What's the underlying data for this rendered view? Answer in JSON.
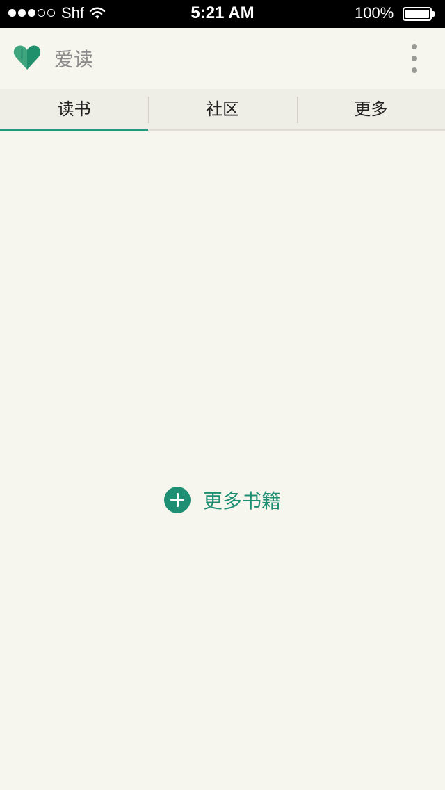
{
  "status_bar": {
    "carrier": "Shf",
    "time": "5:21 AM",
    "battery": "100%"
  },
  "app_bar": {
    "title": "爱读",
    "logo_icon": "heart-book-icon",
    "menu_icon": "more-vertical-icon"
  },
  "tabs": [
    {
      "label": "读书",
      "active": true
    },
    {
      "label": "社区",
      "active": false
    },
    {
      "label": "更多",
      "active": false
    }
  ],
  "main": {
    "add_books_label": "更多书籍",
    "add_icon": "plus-circle-icon"
  },
  "colors": {
    "accent": "#1f8f73",
    "background": "#f7f6ee",
    "tab_background": "#efeee6"
  }
}
